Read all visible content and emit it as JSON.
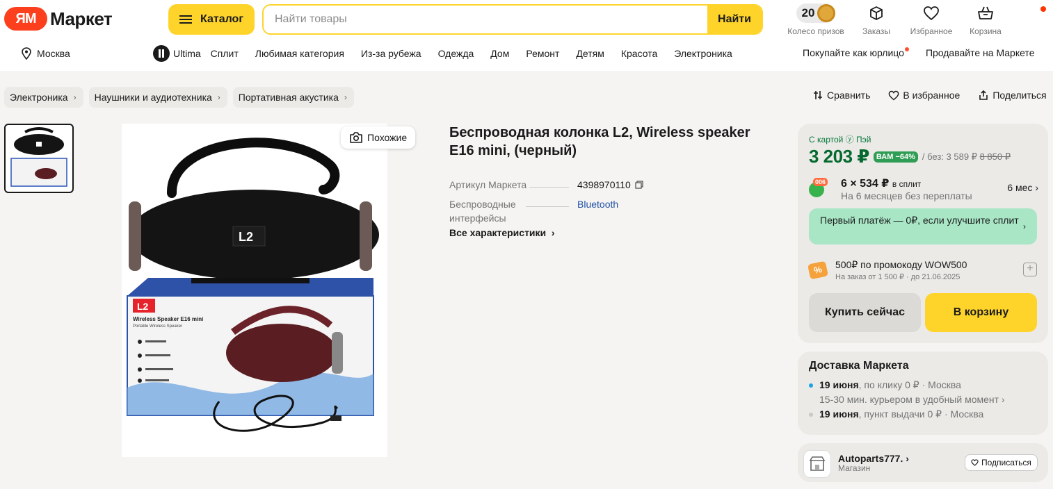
{
  "header": {
    "logo_badge": "ЯМ",
    "logo_text": "Маркет",
    "catalog_label": "Каталог",
    "search_placeholder": "Найти товары",
    "search_button": "Найти",
    "wheel_points": "20",
    "wheel_label": "Колесо призов",
    "orders_label": "Заказы",
    "favorites_label": "Избранное",
    "cart_label": "Корзина"
  },
  "subnav": {
    "city": "Москва",
    "ultima": "Ultima",
    "links": [
      "Сплит",
      "Любимая категория",
      "Из-за рубежа",
      "Одежда",
      "Дом",
      "Ремонт",
      "Детям",
      "Красота",
      "Электроника"
    ],
    "business": "Покупайте как юрлицо",
    "sell": "Продавайте на Маркете"
  },
  "breadcrumbs": [
    "Электроника",
    "Наушники и аудиотехника",
    "Портативная акустика"
  ],
  "page_actions": {
    "compare": "Сравнить",
    "favorite": "В избранное",
    "share": "Поделиться"
  },
  "gallery": {
    "similar_label": "Похожие",
    "box_brand": "L2",
    "box_title": "Wireless Speaker E16 mini",
    "box_subtitle": "Portable Wireless Speaker"
  },
  "product": {
    "title": "Беспроводная колонка L2, Wireless speaker E16 mini, (черный)",
    "specs": [
      {
        "name": "Артикул Маркета",
        "value": "4398970110"
      },
      {
        "name": "Беспроводные интерфейсы",
        "value": "Bluetooth"
      }
    ],
    "all_specs": "Все характеристики"
  },
  "buybox": {
    "card_label": "С картой ⓨ Пэй",
    "price": "3 203 ₽",
    "discount": "ВАМ −64%",
    "price_without_prefix": "/ без: 3 589 ₽",
    "price_old": "8 850 ₽",
    "split_badge": "006",
    "split_main": "6 × 534 ₽",
    "split_main_suffix": "в сплит",
    "split_sub": "На 6 месяцев без переплаты",
    "split_months": "6 мес",
    "first_payment": "Первый платёж — 0₽, если улучшите сплит",
    "promo_title": "500₽ по промокоду WOW500",
    "promo_sub": "На заказ от 1 500 ₽ · до 21.06.2025",
    "buy_now": "Купить сейчас",
    "add_to_cart": "В корзину"
  },
  "delivery": {
    "title": "Доставка Маркета",
    "rows": [
      {
        "date": "19 июня",
        "text": ", по клику  0 ₽ · Москва",
        "sub": "15-30 мин. курьером в удобный момент ›",
        "color": "#1aa1e6"
      },
      {
        "date": "19 июня",
        "text": ", пункт выдачи  0 ₽ · Москва",
        "color": "#c9c9c9"
      }
    ]
  },
  "seller": {
    "name": "Autoparts777. ›",
    "type": "Магазин",
    "subscribe": "Подписаться"
  },
  "colors": {
    "accent_yellow": "#fed42b",
    "price_green": "#06692f",
    "brand_red": "#fc3f1d"
  }
}
